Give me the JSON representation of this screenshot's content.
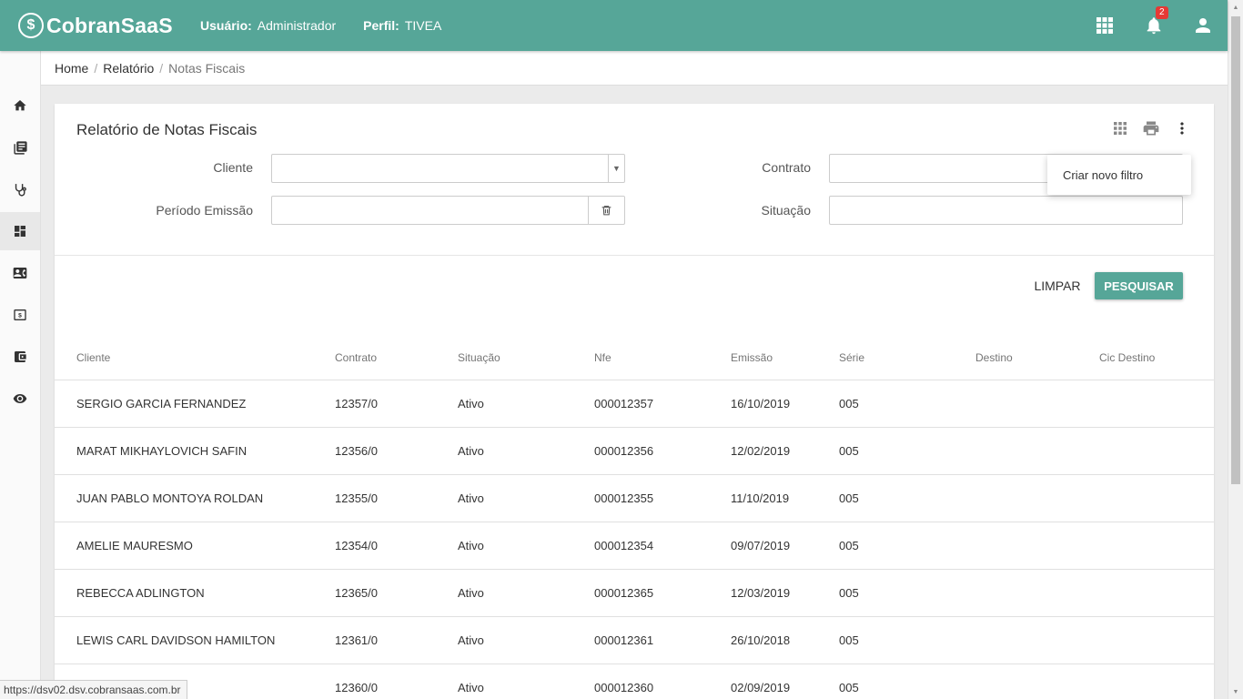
{
  "header": {
    "brand": "CobranSaaS",
    "logo_symbol": "$",
    "user_label": "Usuário:",
    "user_value": "Administrador",
    "profile_label": "Perfil:",
    "profile_value": "TIVEA",
    "notification_count": "2",
    "icons": [
      "apps-grid-icon",
      "bell-icon",
      "user-icon"
    ],
    "color": "#56a698"
  },
  "sidebar": {
    "items": [
      {
        "icon": "home-icon",
        "active": false
      },
      {
        "icon": "book-icon",
        "active": false
      },
      {
        "icon": "stethoscope-icon",
        "active": false
      },
      {
        "icon": "dashboard-icon",
        "active": true
      },
      {
        "icon": "contact-card-icon",
        "active": false
      },
      {
        "icon": "money-icon",
        "active": false
      },
      {
        "icon": "wallet-icon",
        "active": false
      },
      {
        "icon": "eye-icon",
        "active": false
      }
    ]
  },
  "breadcrumb": {
    "items": [
      "Home",
      "Relatório"
    ],
    "current": "Notas Fiscais",
    "separator": "/"
  },
  "report": {
    "title": "Relatório de Notas Fiscais",
    "tools": [
      "grid-icon",
      "print-icon",
      "more-vert-icon"
    ]
  },
  "filters": {
    "cliente_label": "Cliente",
    "cliente_value": "",
    "contrato_label": "Contrato",
    "contrato_value": "",
    "periodo_label": "Período Emissão",
    "periodo_value": "",
    "situacao_label": "Situação",
    "situacao_value": ""
  },
  "actions": {
    "clear_label": "LIMPAR",
    "search_label": "PESQUISAR"
  },
  "menu": {
    "new_filter": "Criar novo filtro"
  },
  "table": {
    "columns": [
      "Cliente",
      "Contrato",
      "Situação",
      "Nfe",
      "Emissão",
      "Série",
      "Destino",
      "Cic Destino"
    ],
    "rows": [
      {
        "cliente": "SERGIO GARCIA FERNANDEZ",
        "contrato": "12357/0",
        "situacao": "Ativo",
        "nfe": "000012357",
        "emissao": "16/10/2019",
        "serie": "005",
        "destino": "",
        "cic_destino": ""
      },
      {
        "cliente": "MARAT MIKHAYLOVICH SAFIN",
        "contrato": "12356/0",
        "situacao": "Ativo",
        "nfe": "000012356",
        "emissao": "12/02/2019",
        "serie": "005",
        "destino": "",
        "cic_destino": ""
      },
      {
        "cliente": "JUAN PABLO MONTOYA ROLDAN",
        "contrato": "12355/0",
        "situacao": "Ativo",
        "nfe": "000012355",
        "emissao": "11/10/2019",
        "serie": "005",
        "destino": "",
        "cic_destino": ""
      },
      {
        "cliente": "AMELIE MAURESMO",
        "contrato": "12354/0",
        "situacao": "Ativo",
        "nfe": "000012354",
        "emissao": "09/07/2019",
        "serie": "005",
        "destino": "",
        "cic_destino": ""
      },
      {
        "cliente": "REBECCA ADLINGTON",
        "contrato": "12365/0",
        "situacao": "Ativo",
        "nfe": "000012365",
        "emissao": "12/03/2019",
        "serie": "005",
        "destino": "",
        "cic_destino": ""
      },
      {
        "cliente": "LEWIS CARL DAVIDSON HAMILTON",
        "contrato": "12361/0",
        "situacao": "Ativo",
        "nfe": "000012361",
        "emissao": "26/10/2018",
        "serie": "005",
        "destino": "",
        "cic_destino": ""
      },
      {
        "cliente": "",
        "contrato": "12360/0",
        "situacao": "Ativo",
        "nfe": "000012360",
        "emissao": "02/09/2019",
        "serie": "005",
        "destino": "",
        "cic_destino": ""
      }
    ]
  },
  "status_bar": {
    "url": "https://dsv02.dsv.cobransaas.com.br"
  }
}
